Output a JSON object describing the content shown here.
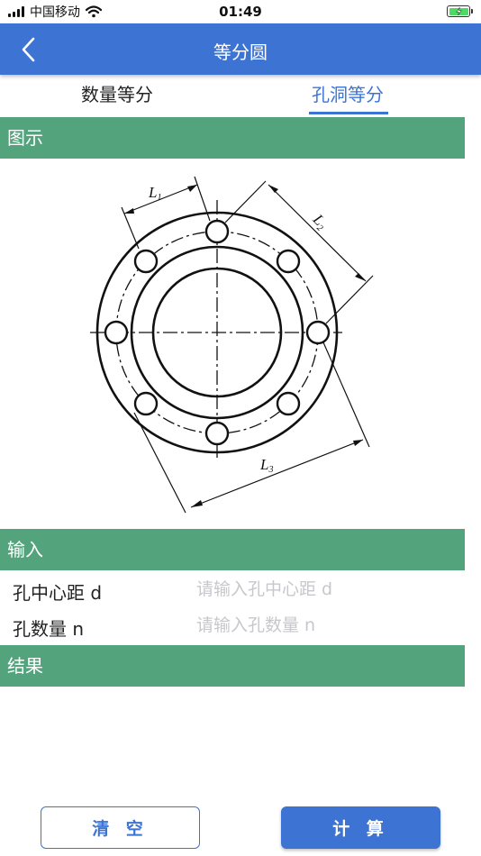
{
  "status_bar": {
    "carrier": "中国移动",
    "time": "01:49",
    "signal_icon": "signal-bars-icon",
    "wifi_icon": "wifi-icon",
    "battery_icon": "battery-charging-icon"
  },
  "nav": {
    "back_icon": "chevron-left-icon",
    "title": "等分圆"
  },
  "tabs": [
    {
      "label": "数量等分",
      "active": false
    },
    {
      "label": "孔洞等分",
      "active": true
    }
  ],
  "sections": {
    "diagram": "图示",
    "input": "输入",
    "result": "结果"
  },
  "diagram_labels": {
    "l1": "L",
    "l1_sub": "1",
    "l2": "L",
    "l2_sub": "2",
    "l3": "L",
    "l3_sub": "3"
  },
  "inputs": [
    {
      "label": "孔中心距 d",
      "placeholder": "请输入孔中心距 d",
      "value": ""
    },
    {
      "label": "孔数量 n",
      "placeholder": "请输入孔数量 n",
      "value": ""
    }
  ],
  "buttons": {
    "clear": "清 空",
    "calculate": "计 算"
  },
  "colors": {
    "primary": "#3d74d3",
    "section_header": "#53a37c",
    "placeholder": "#c7c7cc"
  }
}
